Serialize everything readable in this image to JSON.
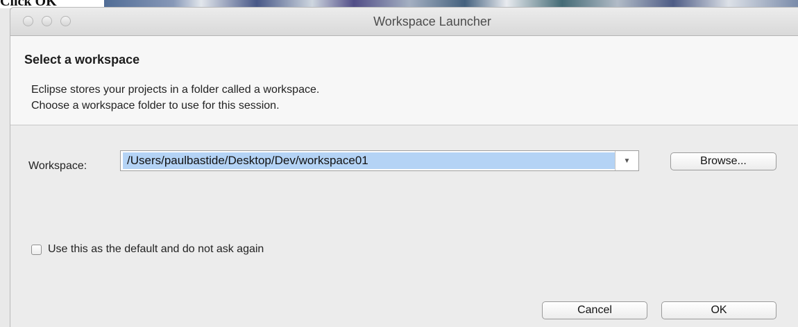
{
  "caption": "Click OK",
  "window": {
    "title": "Workspace Launcher",
    "controls": [
      "close-button",
      "minimize-button",
      "zoom-button"
    ]
  },
  "header": {
    "title": "Select a workspace",
    "description_line1": "Eclipse stores your projects in a folder called a workspace.",
    "description_line2": "Choose a workspace folder to use for this session."
  },
  "workspace": {
    "label": "Workspace:",
    "value": "/Users/paulbastide/Desktop/Dev/workspace01",
    "dropdown_icon": "triangle-down-icon",
    "browse_label": "Browse..."
  },
  "default_checkbox": {
    "label": "Use this as the default and do not ask again",
    "checked": false
  },
  "buttons": {
    "cancel_label": "Cancel",
    "ok_label": "OK"
  },
  "colors": {
    "selection": "#b4d3f5",
    "window_bg": "#ececec",
    "header_bg": "#f7f7f7"
  }
}
